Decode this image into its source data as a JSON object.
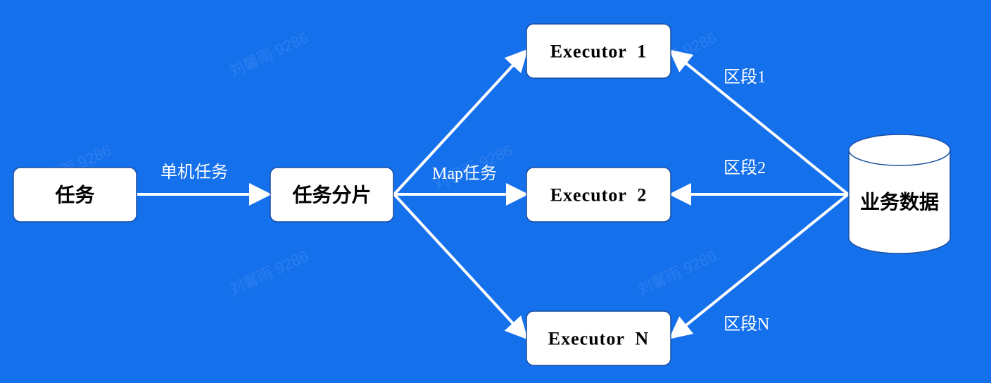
{
  "nodes": {
    "task": "任务",
    "sharding": "任务分片",
    "executor1": "Executor  1",
    "executor2": "Executor  2",
    "executorN": "Executor  N",
    "business_data": "业务数据"
  },
  "edges": {
    "task_to_sharding": "单机任务",
    "map_task": "Map任务",
    "segment1": "区段1",
    "segment2": "区段2",
    "segmentN": "区段N"
  },
  "watermark": "刘馨雨 9286",
  "colors": {
    "background": "#1570ec",
    "node_fill": "#ffffff",
    "arrow": "#ffffff"
  }
}
